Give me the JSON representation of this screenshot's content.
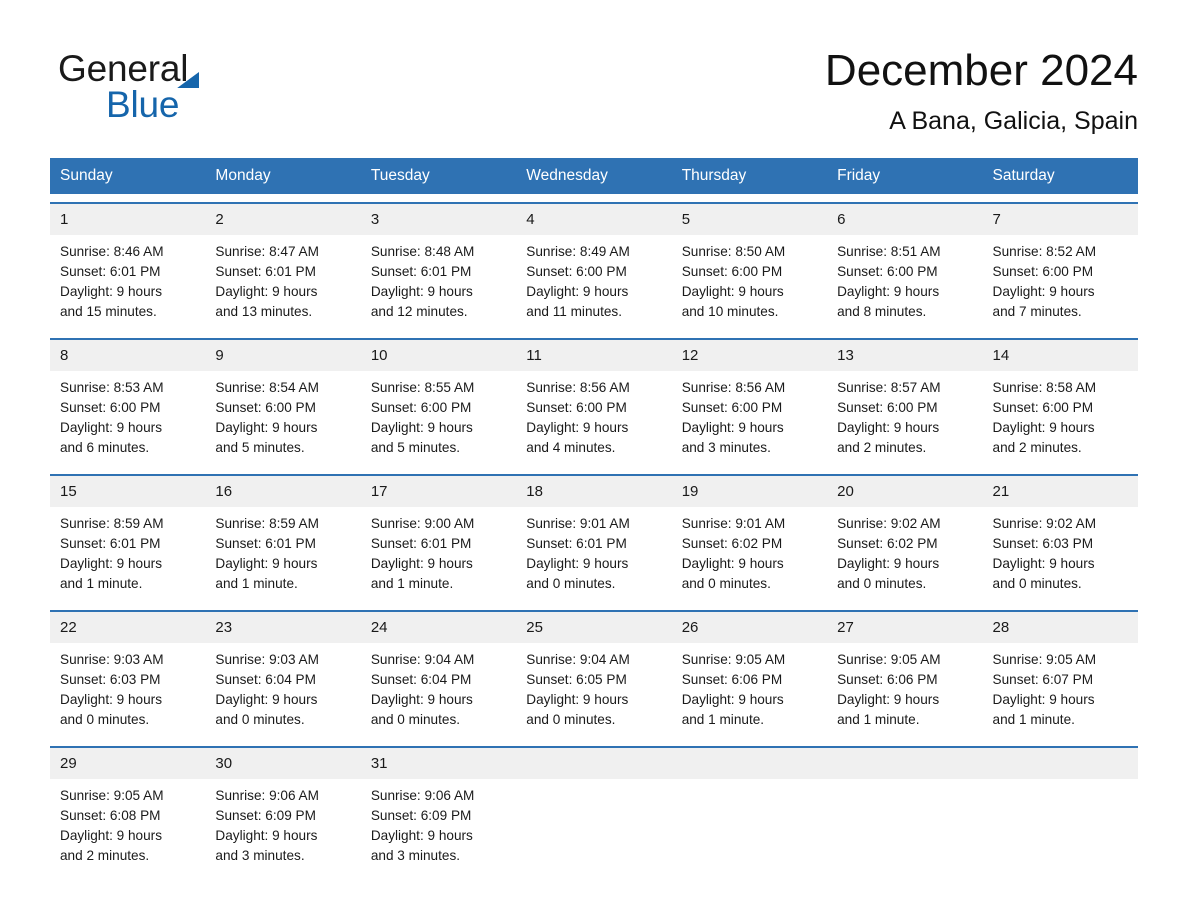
{
  "brand": {
    "name_part1": "General",
    "name_part2": "Blue",
    "triangle_icon": "blue-triangle-icon",
    "accent_color": "#1565ab"
  },
  "header": {
    "month_title": "December 2024",
    "location": "A Bana, Galicia, Spain"
  },
  "theme": {
    "header_blue": "#2f72b3",
    "date_band_gray": "#f0f0f0",
    "rule_blue": "#2f72b3"
  },
  "calendar": {
    "weekdays": [
      "Sunday",
      "Monday",
      "Tuesday",
      "Wednesday",
      "Thursday",
      "Friday",
      "Saturday"
    ],
    "weeks": [
      [
        {
          "day": "1",
          "sunrise": "Sunrise: 8:46 AM",
          "sunset": "Sunset: 6:01 PM",
          "daylight_line1": "Daylight: 9 hours",
          "daylight_line2": "and 15 minutes."
        },
        {
          "day": "2",
          "sunrise": "Sunrise: 8:47 AM",
          "sunset": "Sunset: 6:01 PM",
          "daylight_line1": "Daylight: 9 hours",
          "daylight_line2": "and 13 minutes."
        },
        {
          "day": "3",
          "sunrise": "Sunrise: 8:48 AM",
          "sunset": "Sunset: 6:01 PM",
          "daylight_line1": "Daylight: 9 hours",
          "daylight_line2": "and 12 minutes."
        },
        {
          "day": "4",
          "sunrise": "Sunrise: 8:49 AM",
          "sunset": "Sunset: 6:00 PM",
          "daylight_line1": "Daylight: 9 hours",
          "daylight_line2": "and 11 minutes."
        },
        {
          "day": "5",
          "sunrise": "Sunrise: 8:50 AM",
          "sunset": "Sunset: 6:00 PM",
          "daylight_line1": "Daylight: 9 hours",
          "daylight_line2": "and 10 minutes."
        },
        {
          "day": "6",
          "sunrise": "Sunrise: 8:51 AM",
          "sunset": "Sunset: 6:00 PM",
          "daylight_line1": "Daylight: 9 hours",
          "daylight_line2": "and 8 minutes."
        },
        {
          "day": "7",
          "sunrise": "Sunrise: 8:52 AM",
          "sunset": "Sunset: 6:00 PM",
          "daylight_line1": "Daylight: 9 hours",
          "daylight_line2": "and 7 minutes."
        }
      ],
      [
        {
          "day": "8",
          "sunrise": "Sunrise: 8:53 AM",
          "sunset": "Sunset: 6:00 PM",
          "daylight_line1": "Daylight: 9 hours",
          "daylight_line2": "and 6 minutes."
        },
        {
          "day": "9",
          "sunrise": "Sunrise: 8:54 AM",
          "sunset": "Sunset: 6:00 PM",
          "daylight_line1": "Daylight: 9 hours",
          "daylight_line2": "and 5 minutes."
        },
        {
          "day": "10",
          "sunrise": "Sunrise: 8:55 AM",
          "sunset": "Sunset: 6:00 PM",
          "daylight_line1": "Daylight: 9 hours",
          "daylight_line2": "and 5 minutes."
        },
        {
          "day": "11",
          "sunrise": "Sunrise: 8:56 AM",
          "sunset": "Sunset: 6:00 PM",
          "daylight_line1": "Daylight: 9 hours",
          "daylight_line2": "and 4 minutes."
        },
        {
          "day": "12",
          "sunrise": "Sunrise: 8:56 AM",
          "sunset": "Sunset: 6:00 PM",
          "daylight_line1": "Daylight: 9 hours",
          "daylight_line2": "and 3 minutes."
        },
        {
          "day": "13",
          "sunrise": "Sunrise: 8:57 AM",
          "sunset": "Sunset: 6:00 PM",
          "daylight_line1": "Daylight: 9 hours",
          "daylight_line2": "and 2 minutes."
        },
        {
          "day": "14",
          "sunrise": "Sunrise: 8:58 AM",
          "sunset": "Sunset: 6:00 PM",
          "daylight_line1": "Daylight: 9 hours",
          "daylight_line2": "and 2 minutes."
        }
      ],
      [
        {
          "day": "15",
          "sunrise": "Sunrise: 8:59 AM",
          "sunset": "Sunset: 6:01 PM",
          "daylight_line1": "Daylight: 9 hours",
          "daylight_line2": "and 1 minute."
        },
        {
          "day": "16",
          "sunrise": "Sunrise: 8:59 AM",
          "sunset": "Sunset: 6:01 PM",
          "daylight_line1": "Daylight: 9 hours",
          "daylight_line2": "and 1 minute."
        },
        {
          "day": "17",
          "sunrise": "Sunrise: 9:00 AM",
          "sunset": "Sunset: 6:01 PM",
          "daylight_line1": "Daylight: 9 hours",
          "daylight_line2": "and 1 minute."
        },
        {
          "day": "18",
          "sunrise": "Sunrise: 9:01 AM",
          "sunset": "Sunset: 6:01 PM",
          "daylight_line1": "Daylight: 9 hours",
          "daylight_line2": "and 0 minutes."
        },
        {
          "day": "19",
          "sunrise": "Sunrise: 9:01 AM",
          "sunset": "Sunset: 6:02 PM",
          "daylight_line1": "Daylight: 9 hours",
          "daylight_line2": "and 0 minutes."
        },
        {
          "day": "20",
          "sunrise": "Sunrise: 9:02 AM",
          "sunset": "Sunset: 6:02 PM",
          "daylight_line1": "Daylight: 9 hours",
          "daylight_line2": "and 0 minutes."
        },
        {
          "day": "21",
          "sunrise": "Sunrise: 9:02 AM",
          "sunset": "Sunset: 6:03 PM",
          "daylight_line1": "Daylight: 9 hours",
          "daylight_line2": "and 0 minutes."
        }
      ],
      [
        {
          "day": "22",
          "sunrise": "Sunrise: 9:03 AM",
          "sunset": "Sunset: 6:03 PM",
          "daylight_line1": "Daylight: 9 hours",
          "daylight_line2": "and 0 minutes."
        },
        {
          "day": "23",
          "sunrise": "Sunrise: 9:03 AM",
          "sunset": "Sunset: 6:04 PM",
          "daylight_line1": "Daylight: 9 hours",
          "daylight_line2": "and 0 minutes."
        },
        {
          "day": "24",
          "sunrise": "Sunrise: 9:04 AM",
          "sunset": "Sunset: 6:04 PM",
          "daylight_line1": "Daylight: 9 hours",
          "daylight_line2": "and 0 minutes."
        },
        {
          "day": "25",
          "sunrise": "Sunrise: 9:04 AM",
          "sunset": "Sunset: 6:05 PM",
          "daylight_line1": "Daylight: 9 hours",
          "daylight_line2": "and 0 minutes."
        },
        {
          "day": "26",
          "sunrise": "Sunrise: 9:05 AM",
          "sunset": "Sunset: 6:06 PM",
          "daylight_line1": "Daylight: 9 hours",
          "daylight_line2": "and 1 minute."
        },
        {
          "day": "27",
          "sunrise": "Sunrise: 9:05 AM",
          "sunset": "Sunset: 6:06 PM",
          "daylight_line1": "Daylight: 9 hours",
          "daylight_line2": "and 1 minute."
        },
        {
          "day": "28",
          "sunrise": "Sunrise: 9:05 AM",
          "sunset": "Sunset: 6:07 PM",
          "daylight_line1": "Daylight: 9 hours",
          "daylight_line2": "and 1 minute."
        }
      ],
      [
        {
          "day": "29",
          "sunrise": "Sunrise: 9:05 AM",
          "sunset": "Sunset: 6:08 PM",
          "daylight_line1": "Daylight: 9 hours",
          "daylight_line2": "and 2 minutes."
        },
        {
          "day": "30",
          "sunrise": "Sunrise: 9:06 AM",
          "sunset": "Sunset: 6:09 PM",
          "daylight_line1": "Daylight: 9 hours",
          "daylight_line2": "and 3 minutes."
        },
        {
          "day": "31",
          "sunrise": "Sunrise: 9:06 AM",
          "sunset": "Sunset: 6:09 PM",
          "daylight_line1": "Daylight: 9 hours",
          "daylight_line2": "and 3 minutes."
        },
        {
          "day": "",
          "sunrise": "",
          "sunset": "",
          "daylight_line1": "",
          "daylight_line2": ""
        },
        {
          "day": "",
          "sunrise": "",
          "sunset": "",
          "daylight_line1": "",
          "daylight_line2": ""
        },
        {
          "day": "",
          "sunrise": "",
          "sunset": "",
          "daylight_line1": "",
          "daylight_line2": ""
        },
        {
          "day": "",
          "sunrise": "",
          "sunset": "",
          "daylight_line1": "",
          "daylight_line2": ""
        }
      ]
    ]
  }
}
